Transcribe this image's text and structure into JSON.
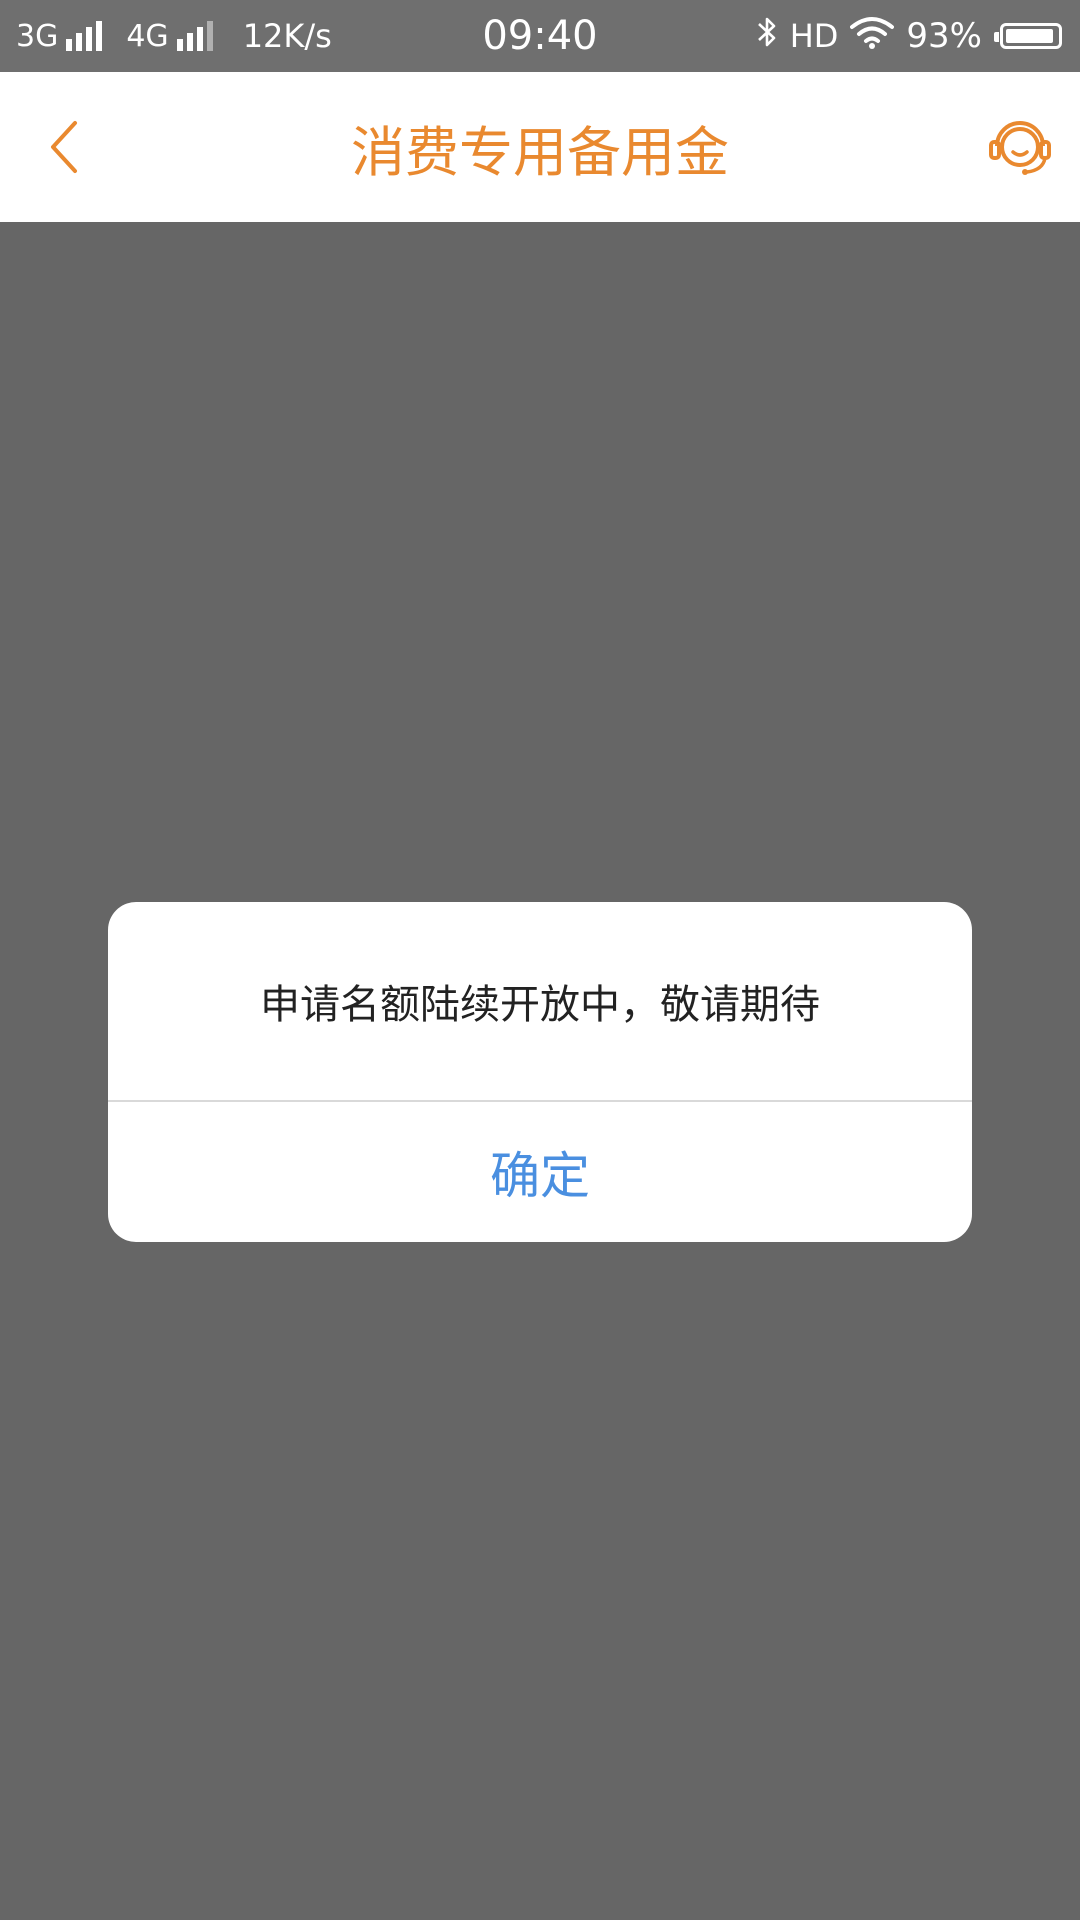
{
  "status_bar": {
    "network1": "3G",
    "network2": "4G",
    "speed": "12K/s",
    "time": "09:40",
    "hd": "HD",
    "battery_percent": "93%",
    "battery_level": 0.93,
    "icons": [
      "signal-icon",
      "bluetooth-icon",
      "wifi-icon",
      "battery-icon"
    ]
  },
  "nav": {
    "title": "消费专用备用金",
    "back_icon": "chevron-left-icon",
    "service_icon": "customer-service-headset-icon",
    "accent_color": "#e9892f"
  },
  "dialog": {
    "message": "申请名额陆续开放中，敬请期待",
    "confirm_label": "确定",
    "confirm_color": "#4a8fe0"
  },
  "colors": {
    "overlay": "#666666",
    "status_bar": "#6f6f6f"
  }
}
